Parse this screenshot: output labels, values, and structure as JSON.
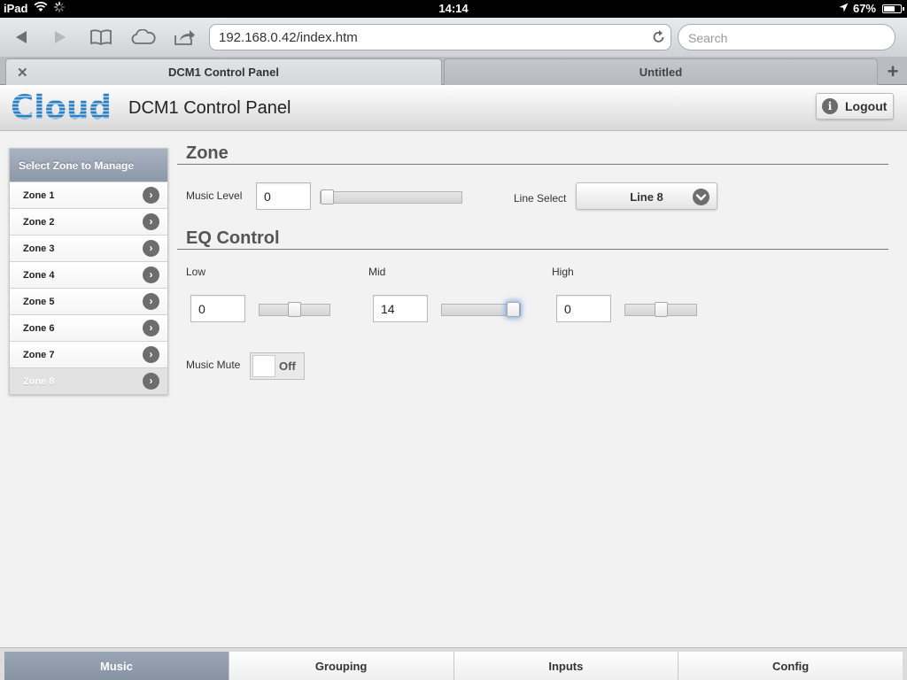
{
  "status_bar": {
    "device": "iPad",
    "time": "14:14",
    "battery": "67%",
    "battery_level": 0.67
  },
  "browser": {
    "url": "192.168.0.42/index.htm",
    "search_placeholder": "Search",
    "tabs": [
      {
        "title": "DCM1 Control Panel",
        "active": true
      },
      {
        "title": "Untitled",
        "active": false
      }
    ]
  },
  "header": {
    "logo_text": "Cloud",
    "title": "DCM1 Control Panel",
    "logout_label": "Logout"
  },
  "sidebar": {
    "heading": "Select Zone to Manage",
    "zones": [
      {
        "label": "Zone 1"
      },
      {
        "label": "Zone 2"
      },
      {
        "label": "Zone 3"
      },
      {
        "label": "Zone 4"
      },
      {
        "label": "Zone 5"
      },
      {
        "label": "Zone 6"
      },
      {
        "label": "Zone 7"
      },
      {
        "label": "Zone 8",
        "selected": true
      }
    ]
  },
  "zone_section": {
    "title": "Zone",
    "music_level_label": "Music Level",
    "music_level_value": "0",
    "music_level_fraction": 0.0,
    "line_select_label": "Line Select",
    "line_select_value": "Line 8"
  },
  "eq_section": {
    "title": "EQ Control",
    "low_label": "Low",
    "low_value": "0",
    "low_fraction": 0.5,
    "mid_label": "Mid",
    "mid_value": "14",
    "mid_fraction": 1.0,
    "high_label": "High",
    "high_value": "0",
    "high_fraction": 0.5,
    "mute_label": "Music Mute",
    "mute_state": "Off"
  },
  "bottom_nav": {
    "items": [
      {
        "label": "Music",
        "active": true
      },
      {
        "label": "Grouping"
      },
      {
        "label": "Inputs"
      },
      {
        "label": "Config"
      }
    ]
  }
}
